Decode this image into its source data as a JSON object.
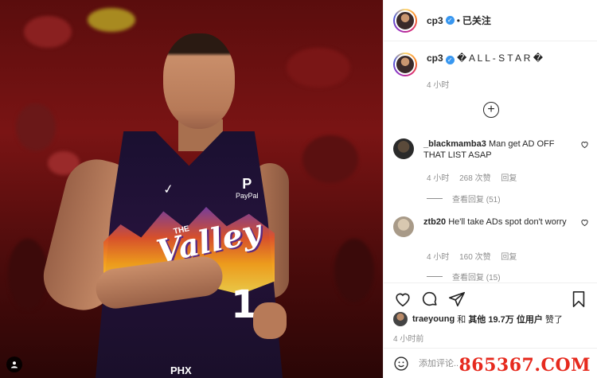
{
  "header": {
    "username": "cp3",
    "separator": "•",
    "follow_state": "已关注"
  },
  "caption": {
    "username": "cp3",
    "text": "� A L L - S T A R �",
    "time": "4 小时"
  },
  "comments": [
    {
      "username": "_blackmamba3",
      "text": "Man get AD OFF THAT LIST ASAP",
      "time": "4 小时",
      "likes": "268 次赞",
      "reply": "回复",
      "view_replies": "查看回复 (51)"
    },
    {
      "username": "ztb20",
      "text": "He'll take ADs spot don't worry",
      "time": "4 小时",
      "likes": "160 次赞",
      "reply": "回复",
      "view_replies": "查看回复 (15)"
    }
  ],
  "likes": {
    "first_user": "traeyoung",
    "connector": "和",
    "others": "其他 19.7万 位用户",
    "suffix": "赞了"
  },
  "post_time": "4 小时前",
  "comment_input": {
    "placeholder": "添加评论..."
  },
  "photo": {
    "jersey_text": "Valley",
    "jersey_small": "THE",
    "jersey_number": "1",
    "sponsor": "PayPal",
    "shorts_text": "PHX"
  },
  "watermark": "865367.COM",
  "icons": {
    "verified": "verified-badge-icon",
    "add": "plus-circle-icon",
    "like": "heart-icon",
    "comment": "comment-icon",
    "share": "send-icon",
    "save": "bookmark-icon",
    "emoji": "emoji-icon",
    "tag": "user-tag-icon"
  },
  "colors": {
    "verified": "#3897f0",
    "watermark": "#e62a1e",
    "text": "#262626",
    "muted": "#8e8e8e"
  }
}
